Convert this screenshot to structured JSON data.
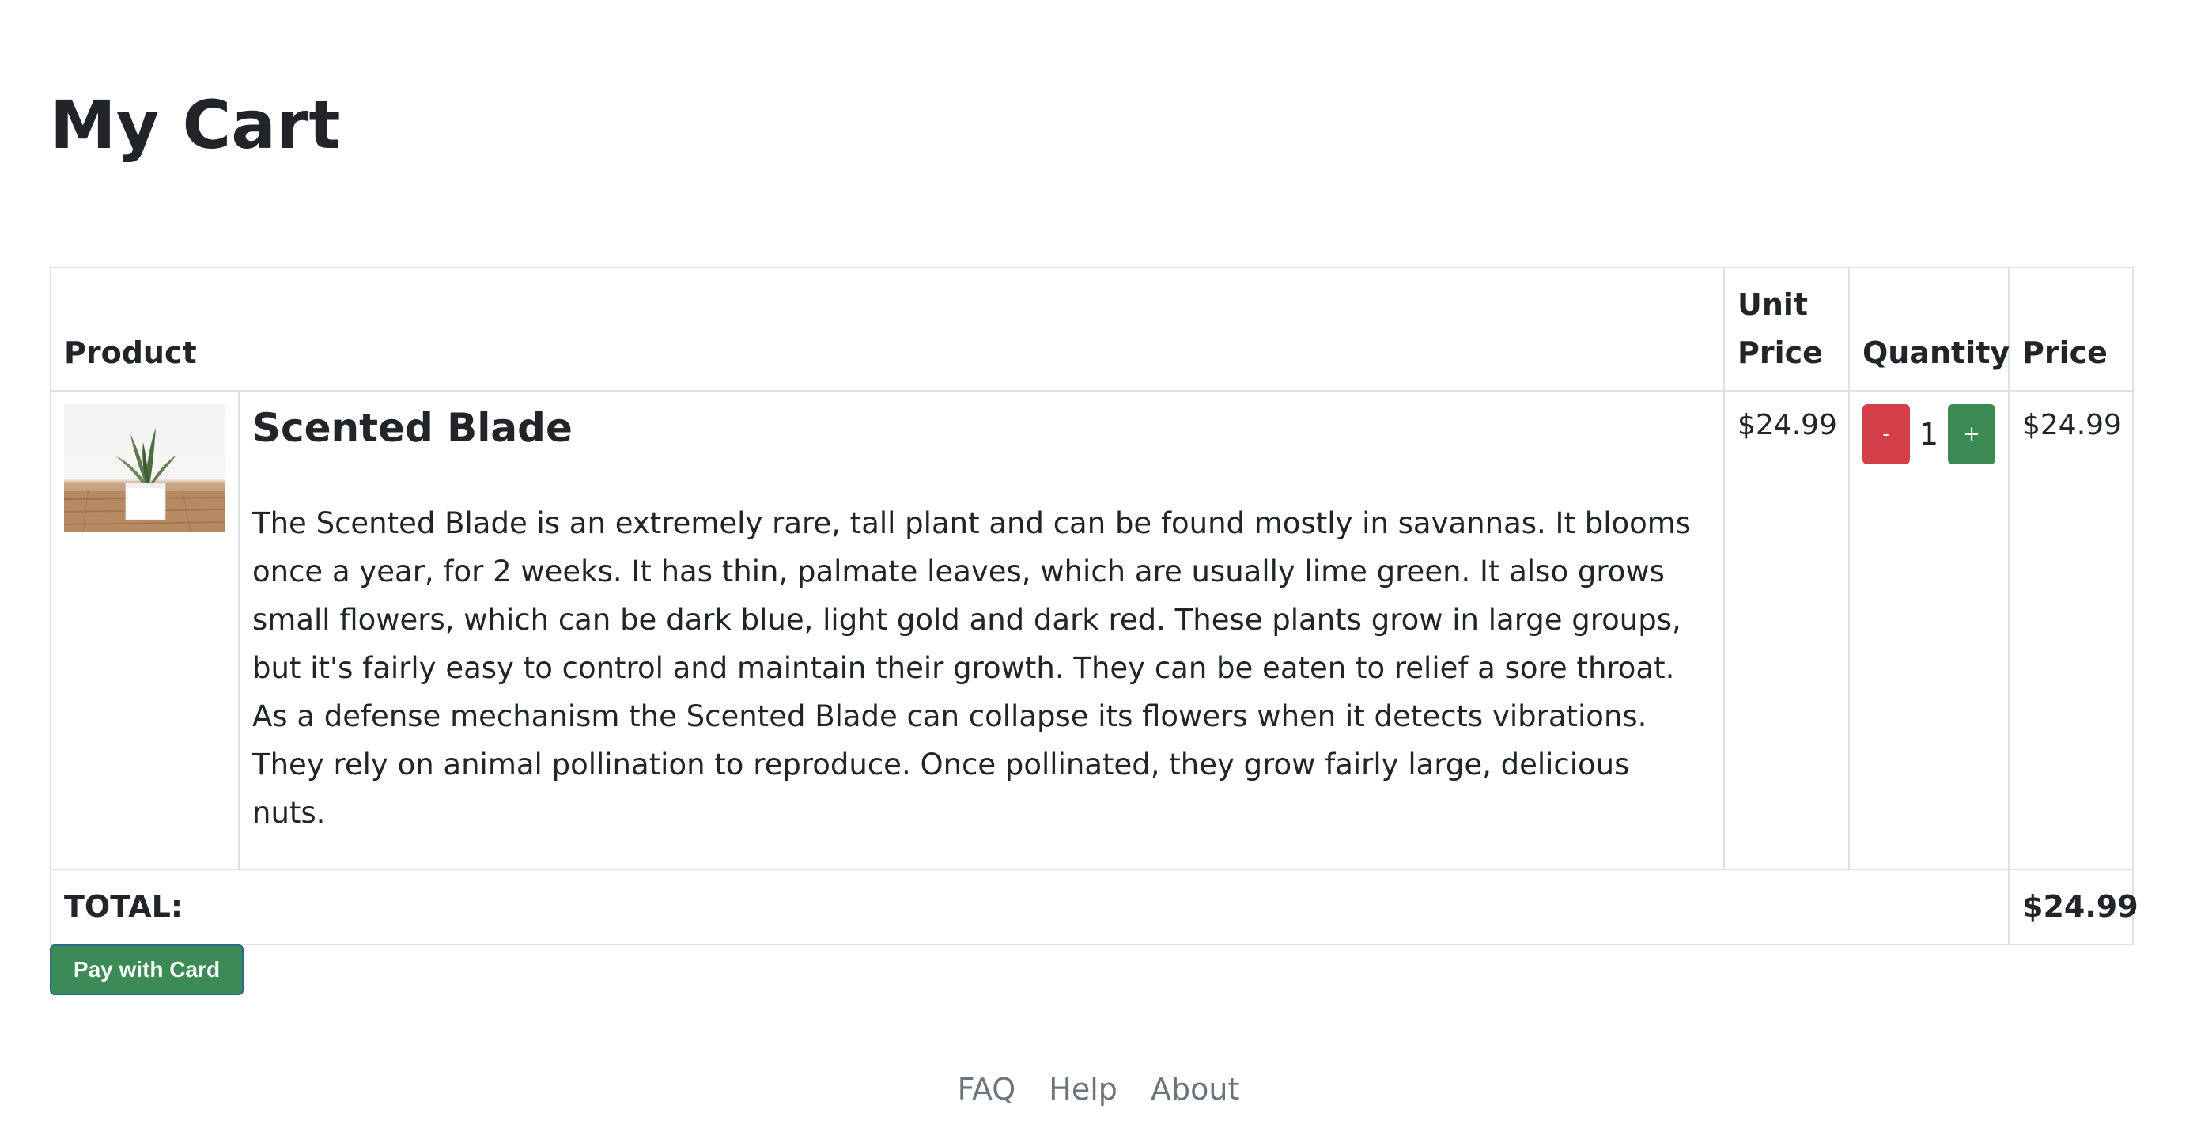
{
  "page": {
    "title": "My Cart"
  },
  "table": {
    "headers": {
      "product": "Product",
      "unit_price": "Unit Price",
      "quantity": "Quantity",
      "price": "Price"
    },
    "items": [
      {
        "name": "Scented Blade",
        "description": "The Scented Blade is an extremely rare, tall plant and can be found mostly in savannas. It blooms once a year, for 2 weeks. It has thin, palmate leaves, which are usually lime green. It also grows small flowers, which can be dark blue, light gold and dark red. These plants grow in large groups, but it's fairly easy to control and maintain their growth. They can be eaten to relief a sore throat. As a defense mechanism the Scented Blade can collapse its flowers when it detects vibrations. They rely on animal pollination to reproduce. Once pollinated, they grow fairly large, delicious nuts.",
        "image_icon": "potted-plant-image",
        "unit_price": "$24.99",
        "quantity": "1",
        "decrement_label": "-",
        "increment_label": "+",
        "price": "$24.99"
      }
    ],
    "total_label": "TOTAL:",
    "total_value": "$24.99"
  },
  "actions": {
    "pay_label": "Pay with Card"
  },
  "footer": {
    "links": [
      "FAQ",
      "Help",
      "About"
    ]
  },
  "colors": {
    "decrement_button": "#d33f49",
    "increment_button": "#3b8a53",
    "pay_button": "#3c8a55",
    "footer_link": "#6c757d",
    "border": "#dee2e6",
    "text": "#212529"
  }
}
